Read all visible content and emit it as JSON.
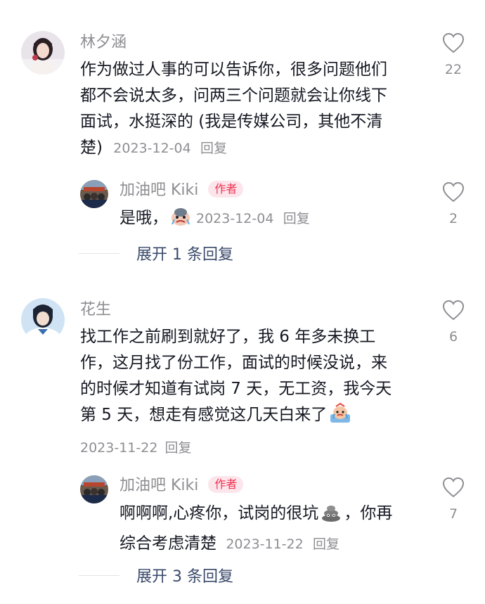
{
  "comments": [
    {
      "username": "林夕涵",
      "text_lines": [
        "作为做过人事的可以告诉你，很多问题他们",
        "都不会说太多，问两三个问题就会让你线下",
        "面试，水挺深的 (我是传媒公司，其他不清",
        "楚)"
      ],
      "date": "2023-12-04",
      "reply_label": "回复",
      "likes": "22",
      "reply": {
        "username": "加油吧 Kiki",
        "badge": "作者",
        "text": "是哦，",
        "emoji": "crying-face-emoji",
        "date": "2023-12-04",
        "reply_label": "回复",
        "likes": "2"
      },
      "expand_label": "展开 1 条回复"
    },
    {
      "username": "花生",
      "text_lines": [
        "找工作之前刷到就好了，我 6 年多未换工",
        "作，这月找了份工作，面试的时候没说，来",
        "的时候才知道有试岗 7 天，无工资，我今天",
        "第 5 天，想走有感觉这几天白来了"
      ],
      "emoji": "crying-bath-emoji",
      "date": "2023-11-22",
      "reply_label": "回复",
      "likes": "6",
      "reply": {
        "username": "加油吧 Kiki",
        "badge": "作者",
        "text_line1_a": "啊啊啊,心疼你，试岗的很坑",
        "text_line1_b": "，你再",
        "text_line2": "综合考虑清楚",
        "emoji": "poop-emoji",
        "date": "2023-11-22",
        "reply_label": "回复",
        "likes": "7"
      },
      "expand_label": "展开 3 条回复"
    }
  ],
  "colors": {
    "text": "#161823",
    "secondary": "#8e8e93",
    "badge_bg": "#fde6eb",
    "badge_text": "#f0304f",
    "expand_text": "#3a4a6b"
  }
}
